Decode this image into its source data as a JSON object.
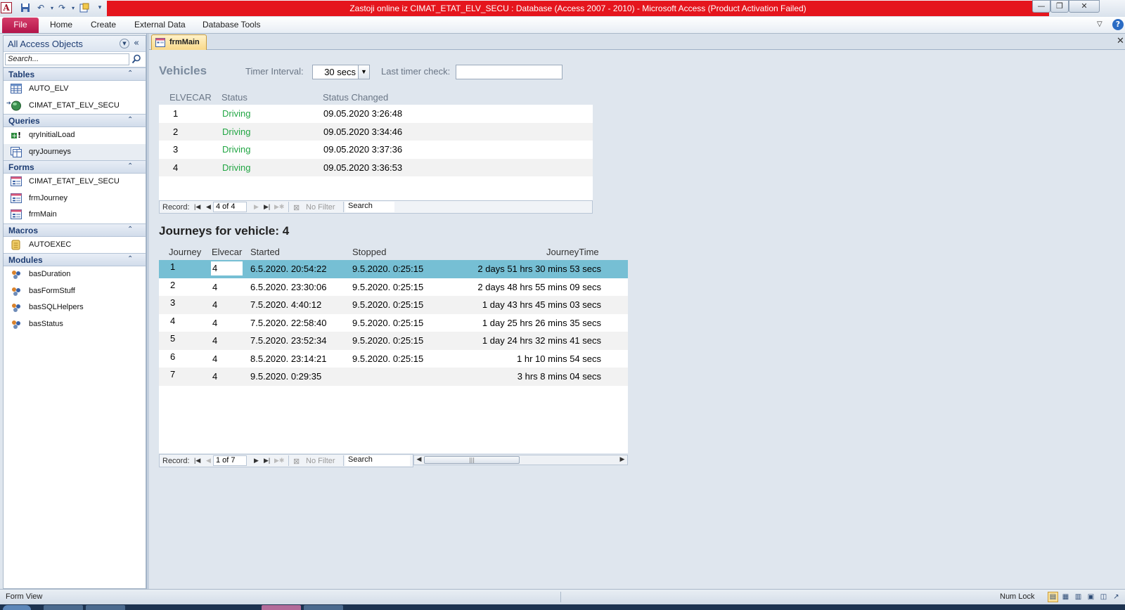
{
  "window": {
    "title": "Zastoji online iz CIMAT_ETAT_ELV_SECU : Database (Access 2007 - 2010)  -  Microsoft Access (Product Activation Failed)"
  },
  "ribbon": {
    "file": "File",
    "tabs": [
      "Home",
      "Create",
      "External Data",
      "Database Tools"
    ]
  },
  "nav": {
    "title": "All Access Objects",
    "search_placeholder": "Search...",
    "groups": [
      {
        "title": "Tables",
        "items": [
          {
            "label": "AUTO_ELV",
            "icon": "table-icon"
          },
          {
            "label": "CIMAT_ETAT_ELV_SECU",
            "icon": "linked-table-icon"
          }
        ]
      },
      {
        "title": "Queries",
        "items": [
          {
            "label": "qryInitialLoad",
            "icon": "append-query-icon"
          },
          {
            "label": "qryJourneys",
            "icon": "select-query-icon"
          }
        ]
      },
      {
        "title": "Forms",
        "items": [
          {
            "label": "CIMAT_ETAT_ELV_SECU",
            "icon": "form-icon"
          },
          {
            "label": "frmJourney",
            "icon": "form-icon"
          },
          {
            "label": "frmMain",
            "icon": "form-icon"
          }
        ]
      },
      {
        "title": "Macros",
        "items": [
          {
            "label": "AUTOEXEC",
            "icon": "macro-icon"
          }
        ]
      },
      {
        "title": "Modules",
        "items": [
          {
            "label": "basDuration",
            "icon": "module-icon"
          },
          {
            "label": "basFormStuff",
            "icon": "module-icon"
          },
          {
            "label": "basSQLHelpers",
            "icon": "module-icon"
          },
          {
            "label": "basStatus",
            "icon": "module-icon"
          }
        ]
      }
    ]
  },
  "doc_tab": {
    "label": "frmMain"
  },
  "form": {
    "vehicles_title": "Vehicles",
    "timer_label": "Timer Interval:",
    "timer_value": "30 secs",
    "last_check_label": "Last timer check:",
    "last_check_value": "",
    "vehicles": {
      "columns": [
        "ELVECAR",
        "Status",
        "Status Changed"
      ],
      "rows": [
        {
          "elvecar": "1",
          "status": "Driving",
          "changed": "09.05.2020 3:26:48"
        },
        {
          "elvecar": "2",
          "status": "Driving",
          "changed": "09.05.2020 3:34:46"
        },
        {
          "elvecar": "3",
          "status": "Driving",
          "changed": "09.05.2020 3:37:36"
        },
        {
          "elvecar": "4",
          "status": "Driving",
          "changed": "09.05.2020 3:36:53"
        }
      ],
      "record_label": "Record:",
      "record_position": "4 of 4",
      "no_filter": "No Filter",
      "search": "Search"
    },
    "journeys_title": "Journeys for vehicle: 4",
    "journeys": {
      "columns": [
        "Journey",
        "Elvecar",
        "Started",
        "Stopped",
        "JourneyTime"
      ],
      "rows": [
        {
          "journey": "1",
          "elvecar": "4",
          "started": "6.5.2020. 20:54:22",
          "stopped": "9.5.2020. 0:25:15",
          "time": "2 days 51 hrs 30 mins 53 secs"
        },
        {
          "journey": "2",
          "elvecar": "4",
          "started": "6.5.2020. 23:30:06",
          "stopped": "9.5.2020. 0:25:15",
          "time": "2 days 48 hrs 55 mins 09 secs"
        },
        {
          "journey": "3",
          "elvecar": "4",
          "started": "7.5.2020. 4:40:12",
          "stopped": "9.5.2020. 0:25:15",
          "time": "1 day 43 hrs 45 mins 03 secs"
        },
        {
          "journey": "4",
          "elvecar": "4",
          "started": "7.5.2020. 22:58:40",
          "stopped": "9.5.2020. 0:25:15",
          "time": "1 day 25 hrs 26 mins 35 secs"
        },
        {
          "journey": "5",
          "elvecar": "4",
          "started": "7.5.2020. 23:52:34",
          "stopped": "9.5.2020. 0:25:15",
          "time": "1 day 24 hrs 32 mins 41 secs"
        },
        {
          "journey": "6",
          "elvecar": "4",
          "started": "8.5.2020. 23:14:21",
          "stopped": "9.5.2020. 0:25:15",
          "time": "1 hr 10 mins 54 secs"
        },
        {
          "journey": "7",
          "elvecar": "4",
          "started": "9.5.2020. 0:29:35",
          "stopped": "",
          "time": "3 hrs 8 mins 04 secs"
        }
      ],
      "record_label": "Record:",
      "record_position": "1 of 7",
      "no_filter": "No Filter",
      "search": "Search"
    }
  },
  "status_bar": {
    "left": "Form View",
    "numlock": "Num Lock"
  },
  "colors": {
    "title_bar": "#e5151d",
    "status_green": "#22a644",
    "selected_row": "#76bfd4",
    "file_tab": "#b3154a"
  }
}
